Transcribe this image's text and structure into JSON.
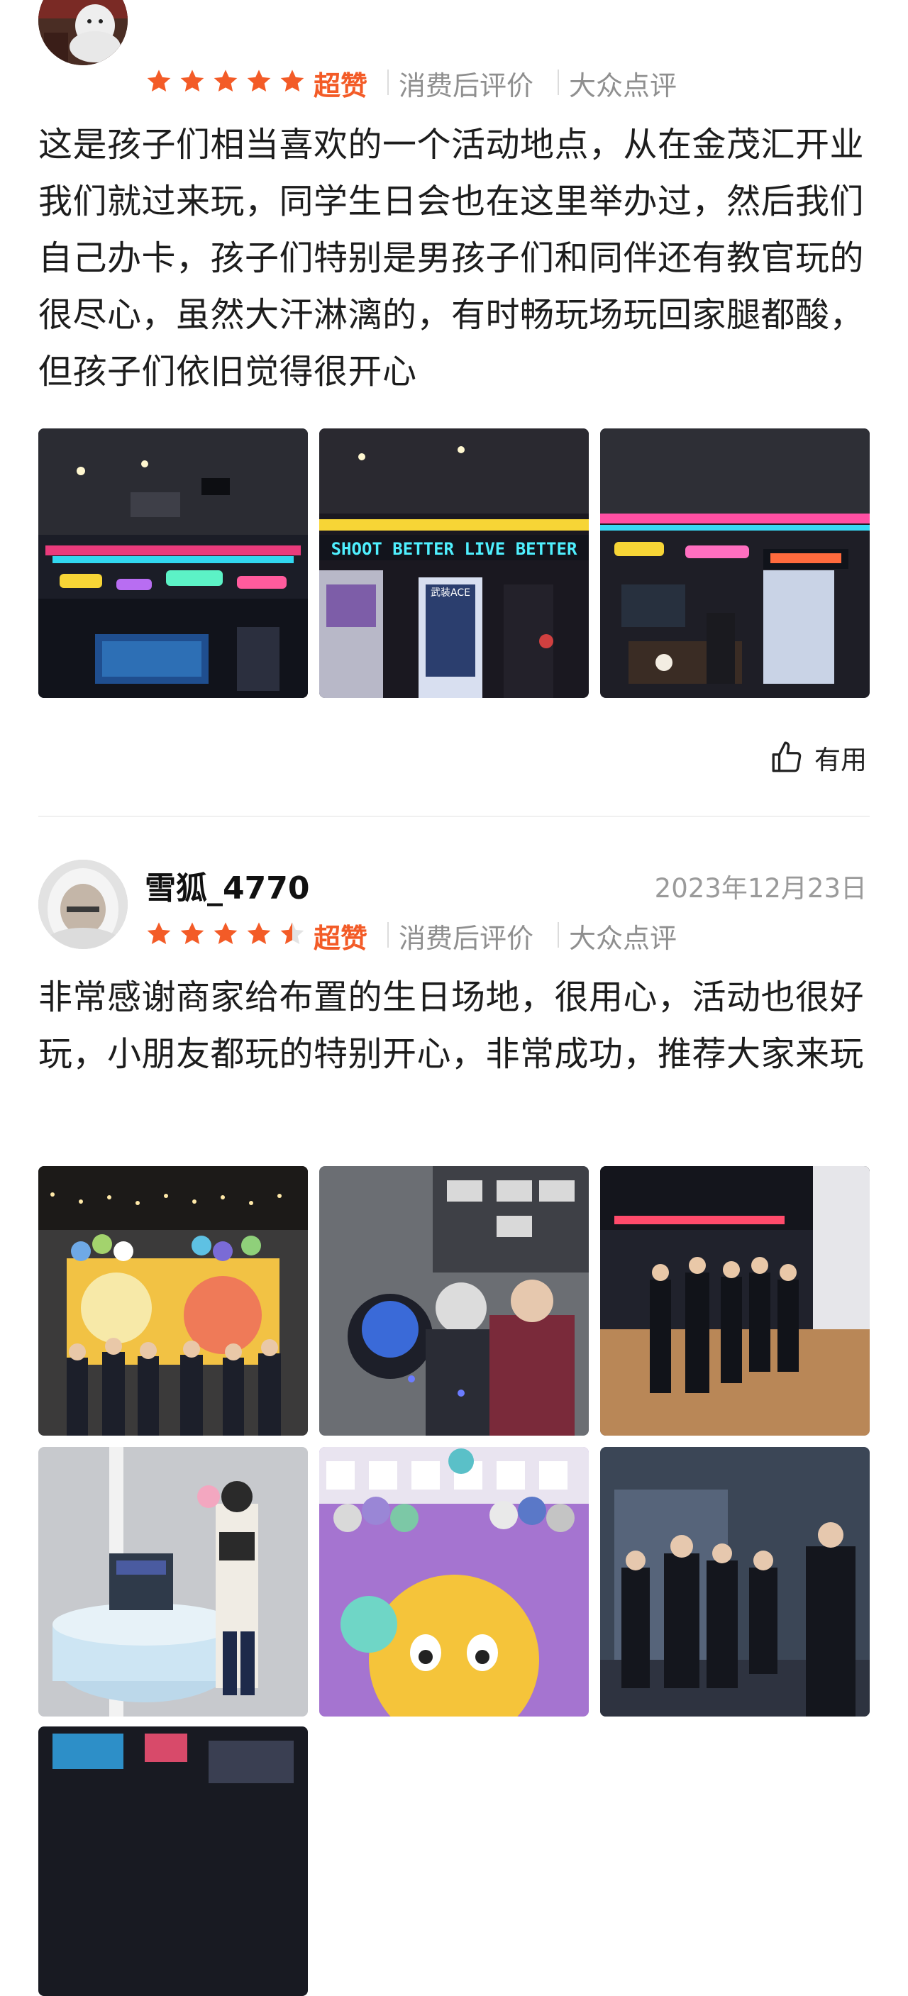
{
  "reviews": [
    {
      "name": "",
      "date": "",
      "rating": 5,
      "badge": "超赞",
      "meta1": "消费后评价",
      "meta2": "大众点评",
      "content": "这是孩子们相当喜欢的一个活动地点，从在金茂汇开业我们就过来玩，同学生日会也在这里举办过，然后我们自己办卡，孩子们特别是男孩子们和同伴还有教官玩的很尽心，虽然大汗淋漓的，有时畅玩场玩回家腿都酸，但孩子们依旧觉得很开心",
      "useful_label": "有用"
    },
    {
      "name": "雪狐_4770",
      "date": "2023年12月23日",
      "rating": 4.5,
      "badge": "超赞",
      "meta1": "消费后评价",
      "meta2": "大众点评",
      "content": "非常感谢商家给布置的生日场地，很用心，活动也很好玩，小朋友都玩的特别开心，非常成功，推荐大家来玩"
    }
  ],
  "photo_signs": {
    "shoot_better": "SHOOT BETTER  LIVE  BETTER",
    "poster": "武装ACE"
  },
  "colors": {
    "accent": "#f35b27",
    "star": "#f35b27",
    "meta": "#8f8f8f"
  }
}
